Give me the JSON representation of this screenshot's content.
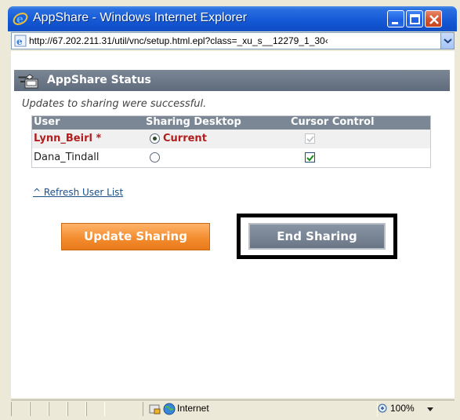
{
  "window": {
    "title": "AppShare - Windows Internet Explorer",
    "title_icon": "ie-logo-icon"
  },
  "addressbar": {
    "url": "http://67.202.211.31/util/vnc/setup.html.epl?class=_xu_s__12279_1_30‹"
  },
  "panel": {
    "title": "AppShare Status",
    "icon": "appshare-icon",
    "status_message": "Updates to sharing were successful."
  },
  "table": {
    "headers": [
      "User",
      "Sharing Desktop",
      "Cursor Control"
    ],
    "rows": [
      {
        "user": "Lynn_Beirl *",
        "sharing": "Current",
        "sharing_selected": true,
        "cursor_control": true,
        "cursor_disabled": true
      },
      {
        "user": "Dana_Tindall",
        "sharing": "",
        "sharing_selected": false,
        "cursor_control": true,
        "cursor_disabled": false
      }
    ]
  },
  "links": {
    "refresh": "^ Refresh User List"
  },
  "buttons": {
    "update": "Update Sharing",
    "end": "End Sharing"
  },
  "statusbar": {
    "zone": "Internet",
    "zoom": "100%"
  },
  "colors": {
    "current_user": "#b21e1e",
    "header_bg": "#7b8795",
    "update_button": "#f28a2c",
    "end_button": "#6f7b8b"
  }
}
